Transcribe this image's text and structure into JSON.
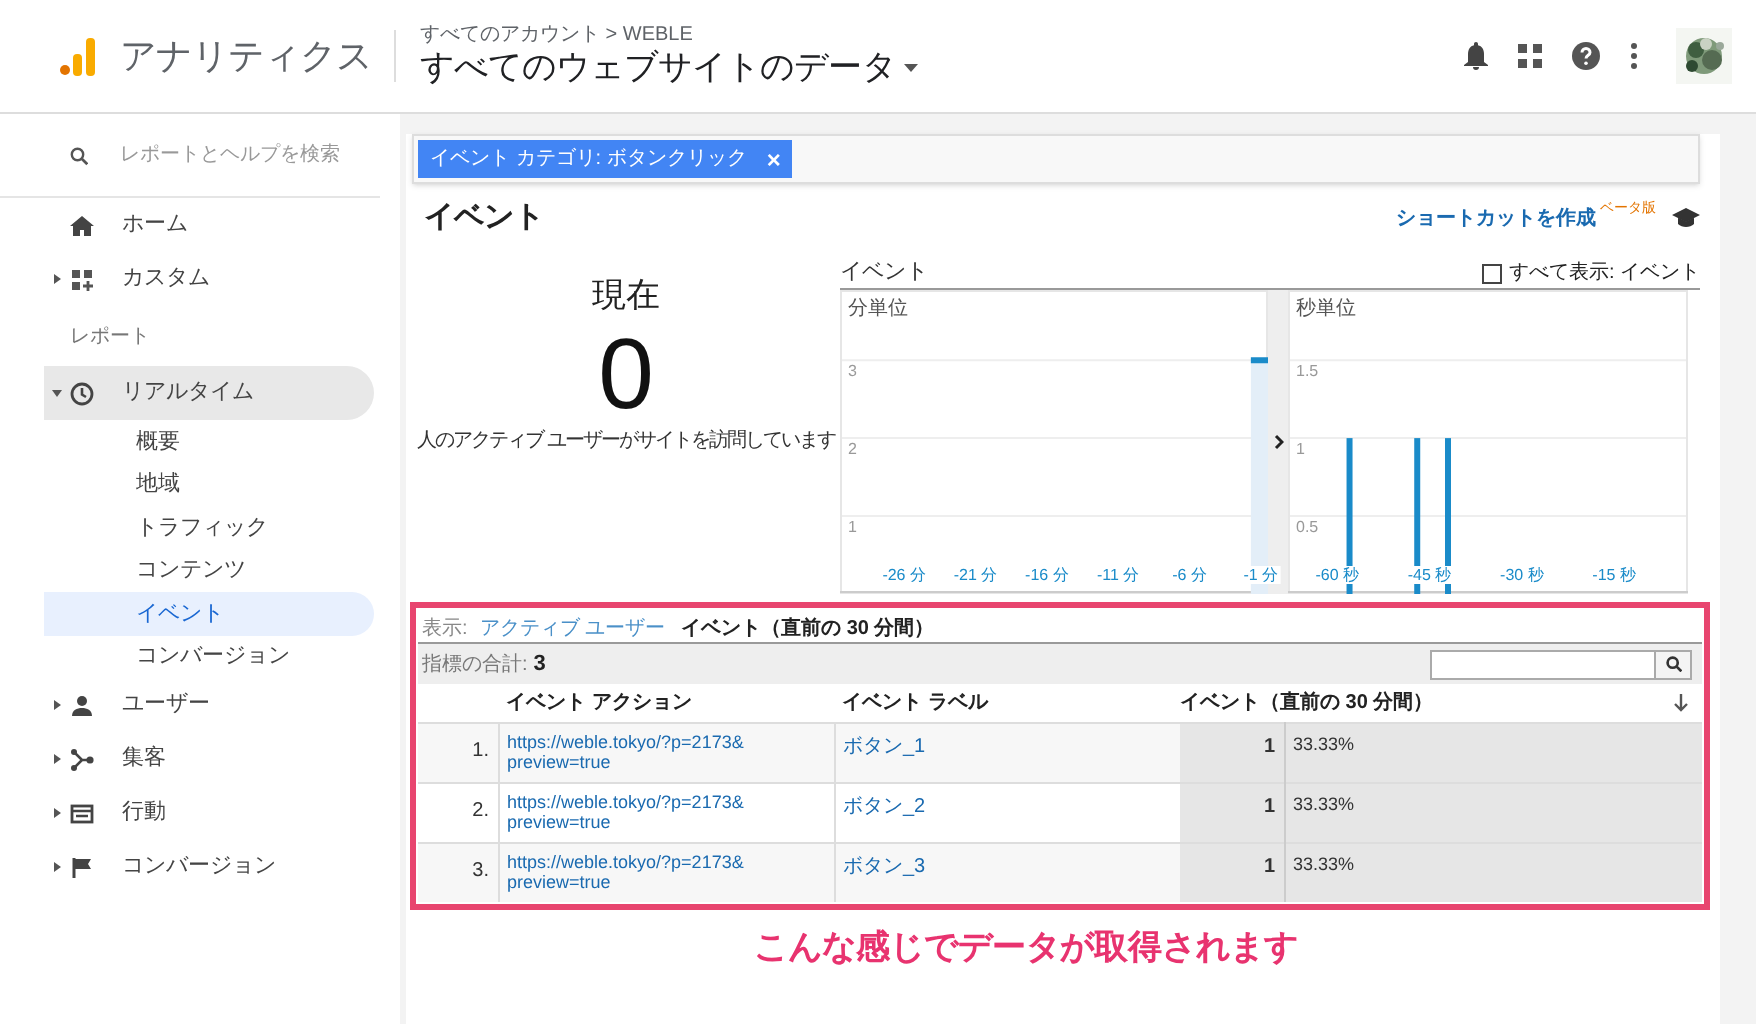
{
  "header": {
    "product": "アナリティクス",
    "breadcrumb": "すべてのアカウント > WEBLE",
    "view": "すべてのウェブサイトのデータ"
  },
  "sidebar": {
    "search_placeholder": "レポートとヘルプを検索",
    "top_items": [
      {
        "label": "ホーム"
      },
      {
        "label": "カスタム",
        "expanded": false
      }
    ],
    "section": "レポート",
    "items": [
      {
        "label": "リアルタイム",
        "expanded": true,
        "children": [
          {
            "label": "概要",
            "selected": false
          },
          {
            "label": "地域",
            "selected": false
          },
          {
            "label": "トラフィック",
            "selected": false
          },
          {
            "label": "コンテンツ",
            "selected": false
          },
          {
            "label": "イベント",
            "selected": true
          },
          {
            "label": "コンバージョン",
            "selected": false
          }
        ]
      },
      {
        "label": "ユーザー",
        "expanded": false
      },
      {
        "label": "集客",
        "expanded": false
      },
      {
        "label": "行動",
        "expanded": false
      },
      {
        "label": "コンバージョン",
        "expanded": false
      }
    ]
  },
  "filter_chip": {
    "label": "イベント カテゴリ: ボタンクリック",
    "close": "×"
  },
  "page": {
    "title": "イベント",
    "shortcut_link": "ショートカットを作成",
    "beta_badge": "ベータ版"
  },
  "current": {
    "heading": "現在",
    "count": "0",
    "caption": "人のアクティブ ユーザーがサイトを訪問しています"
  },
  "charts_header": {
    "title": "イベント",
    "show_all": {
      "label": "すべて表示: イベント",
      "checked": false
    }
  },
  "minute_chart": {
    "chart_data": {
      "type": "bar",
      "title": "分単位",
      "x": [
        -1
      ],
      "values": [
        3
      ],
      "grid": true,
      "xlim": [
        -30.5,
        -0.5
      ],
      "ylim": [
        0,
        3.9
      ],
      "yticks": [
        1,
        2,
        3
      ],
      "xticks": [
        {
          "value": -26,
          "label": "-26 分"
        },
        {
          "value": -21,
          "label": "-21 分"
        },
        {
          "value": -16,
          "label": "-16 分"
        },
        {
          "value": -11,
          "label": "-11 分"
        },
        {
          "value": -6,
          "label": "-6 分"
        },
        {
          "value": -1,
          "label": "-1 分"
        }
      ]
    }
  },
  "second_chart": {
    "chart_data": {
      "type": "bar",
      "title": "秒単位",
      "x": [
        -58,
        -47,
        -42
      ],
      "values": [
        1,
        1,
        1
      ],
      "grid": true,
      "xlim": [
        -68,
        -3
      ],
      "ylim": [
        0,
        1.95
      ],
      "yticks": [
        0.5,
        1,
        1.5
      ],
      "xticks": [
        {
          "value": -60,
          "label": "-60 秒"
        },
        {
          "value": -45,
          "label": "-45 秒"
        },
        {
          "value": -30,
          "label": "-30 秒"
        },
        {
          "value": -15,
          "label": "-15 秒"
        }
      ]
    }
  },
  "table": {
    "view_label": "表示:",
    "tabs": [
      {
        "label": "アクティブ ユーザー",
        "selected": false
      },
      {
        "label": "イベント（直前の 30 分間）",
        "selected": true
      }
    ],
    "total_label": "指標の合計:",
    "total": "3",
    "columns": [
      "イベント アクション",
      "イベント ラベル",
      "イベント（直前の 30 分間）"
    ],
    "rows": [
      {
        "index": "1.",
        "action": "https://weble.tokyo/?p=2173&preview=true",
        "label": "ボタン_1",
        "count": "1",
        "share": "33.33%"
      },
      {
        "index": "2.",
        "action": "https://weble.tokyo/?p=2173&preview=true",
        "label": "ボタン_2",
        "count": "1",
        "share": "33.33%"
      },
      {
        "index": "3.",
        "action": "https://weble.tokyo/?p=2173&preview=true",
        "label": "ボタン_3",
        "count": "1",
        "share": "33.33%"
      }
    ]
  },
  "annotation": {
    "caption": "こんな感じでデータが取得されます"
  }
}
